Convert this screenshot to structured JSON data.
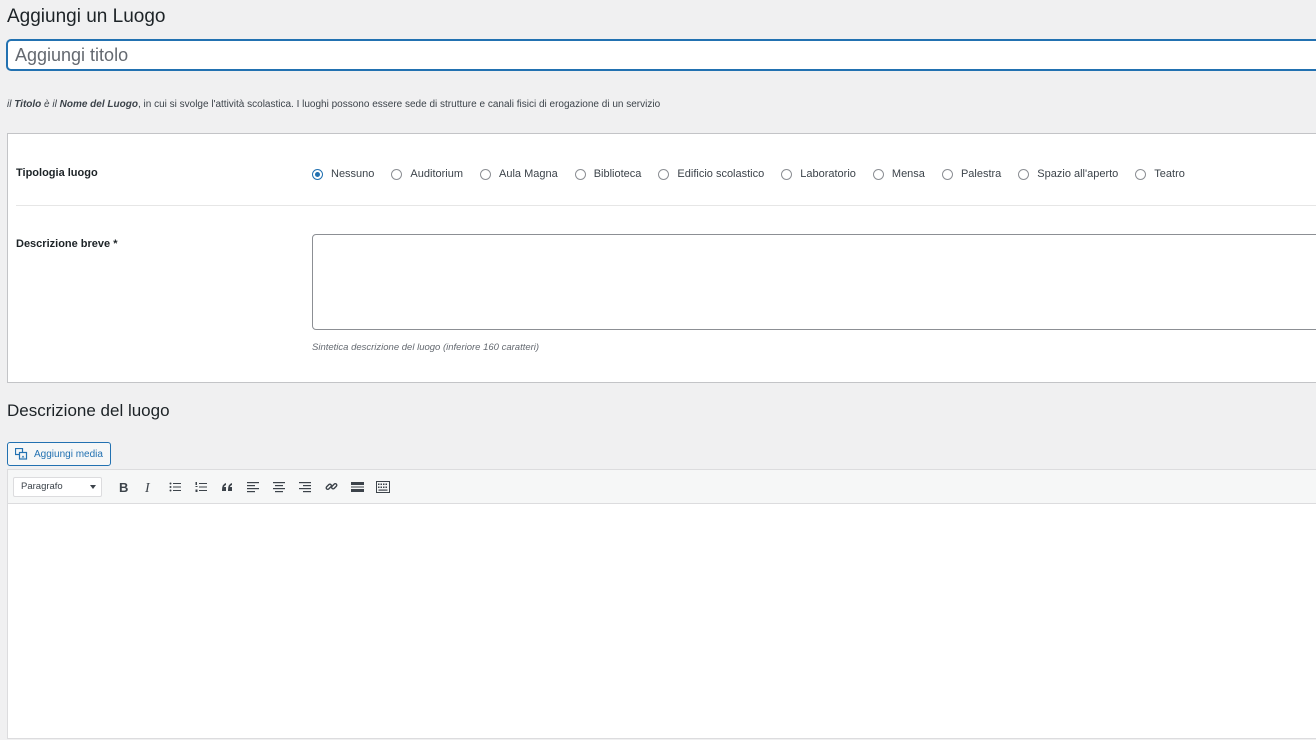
{
  "page": {
    "title": "Aggiungi un Luogo"
  },
  "title_field": {
    "placeholder": "Aggiungi titolo",
    "value": ""
  },
  "help": {
    "part1": "il ",
    "titolo": "Titolo",
    "part2": " è il ",
    "nome": "Nome del Luogo",
    "part3": ", in cui si svolge l'attività scolastica. I luoghi possono essere sede di strutture e canali fisici di erogazione di un servizio"
  },
  "metabox": {
    "tipologia_label": "Tipologia luogo",
    "options": [
      {
        "label": "Nessuno",
        "checked": true
      },
      {
        "label": "Auditorium",
        "checked": false
      },
      {
        "label": "Aula Magna",
        "checked": false
      },
      {
        "label": "Biblioteca",
        "checked": false
      },
      {
        "label": "Edificio scolastico",
        "checked": false
      },
      {
        "label": "Laboratorio",
        "checked": false
      },
      {
        "label": "Mensa",
        "checked": false
      },
      {
        "label": "Palestra",
        "checked": false
      },
      {
        "label": "Spazio all'aperto",
        "checked": false
      },
      {
        "label": "Teatro",
        "checked": false
      }
    ],
    "descrizione_label": "Descrizione breve *",
    "descrizione_value": "",
    "descrizione_help": "Sintetica descrizione del luogo (inferiore 160 caratteri)"
  },
  "editor_section": {
    "title": "Descrizione del luogo",
    "media_button": "Aggiungi media",
    "format_select": "Paragrafo",
    "toolbar_icons": [
      "bold-icon",
      "italic-icon",
      "bullet-list-icon",
      "numbered-list-icon",
      "blockquote-icon",
      "align-left-icon",
      "align-center-icon",
      "align-right-icon",
      "link-icon",
      "read-more-icon",
      "toolbar-toggle-icon"
    ]
  },
  "colors": {
    "accent": "#2271b1",
    "background": "#f0f0f1",
    "panel": "#ffffff",
    "border": "#c3c4c7"
  }
}
